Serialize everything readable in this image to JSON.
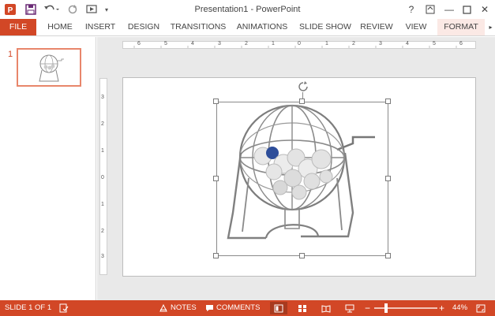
{
  "window": {
    "title": "Presentation1 - PowerPoint",
    "help_label": "?",
    "minimize_label": "—",
    "close_label": "✕"
  },
  "ribbon": {
    "tabs": [
      {
        "label": "FILE"
      },
      {
        "label": "HOME"
      },
      {
        "label": "INSERT"
      },
      {
        "label": "DESIGN"
      },
      {
        "label": "TRANSITIONS"
      },
      {
        "label": "ANIMATIONS"
      },
      {
        "label": "SLIDE SHOW"
      },
      {
        "label": "REVIEW"
      },
      {
        "label": "VIEW"
      },
      {
        "label": "FORMAT"
      }
    ]
  },
  "thumbnails": [
    {
      "number": "1"
    }
  ],
  "rulers": {
    "horizontal_ticks": [
      "6",
      "5",
      "4",
      "3",
      "2",
      "1",
      "0",
      "1",
      "2",
      "3",
      "4",
      "5",
      "6"
    ],
    "vertical_ticks": [
      "3",
      "2",
      "1",
      "0",
      "1",
      "2",
      "3"
    ]
  },
  "slide": {
    "image_icon": "bingo-cage-image"
  },
  "status": {
    "slide_info": "SLIDE 1 OF 1",
    "notes_label": "NOTES",
    "comments_label": "COMMENTS",
    "zoom_out_label": "−",
    "zoom_in_label": "+",
    "zoom_level": "44%",
    "zoom_fraction": 0.44
  },
  "colors": {
    "accent": "#d24726",
    "selected_tab": "#fbe9e5",
    "thumb_border": "#e8866b"
  }
}
